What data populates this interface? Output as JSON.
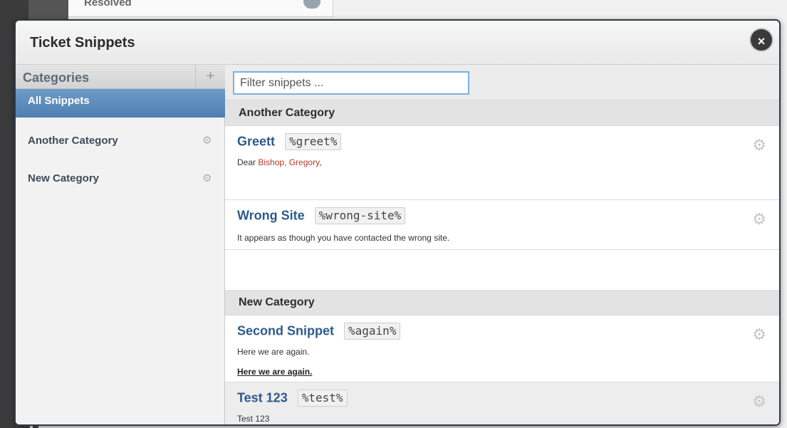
{
  "background": {
    "resolved_label": "Resolved"
  },
  "modal": {
    "title": "Ticket Snippets",
    "close_label": "×"
  },
  "sidebar": {
    "heading": "Categories",
    "add_label": "+",
    "items": [
      {
        "label": "All Snippets",
        "active": true
      },
      {
        "label": "Another Category",
        "gear": "⚙"
      },
      {
        "label": "New Category",
        "gear": "⚙"
      }
    ]
  },
  "filter": {
    "placeholder": "Filter snippets ..."
  },
  "sections": [
    {
      "heading": "Another Category",
      "snippets": [
        {
          "title": "Greett",
          "shortcut": "%greet%",
          "body_prefix": "Dear ",
          "body_name1": "Bishop",
          "body_sep": ", ",
          "body_name2": "Gregory",
          "body_suffix": ","
        },
        {
          "title": "Wrong Site",
          "shortcut": "%wrong-site%",
          "body": "It appears as though you have contacted the wrong site."
        }
      ]
    },
    {
      "heading": "New Category",
      "snippets": [
        {
          "title": "Second Snippet",
          "shortcut": "%again%",
          "body": "Here we are again.",
          "body2": "Here we are again."
        },
        {
          "title": "Test 123",
          "shortcut": "%test%",
          "body": "Test 123"
        }
      ]
    }
  ],
  "icons": {
    "gear": "⚙"
  },
  "colors": {
    "accent": "#4e7fb2",
    "title_blue": "#2d5a8c",
    "name_red": "#b23a2a"
  }
}
